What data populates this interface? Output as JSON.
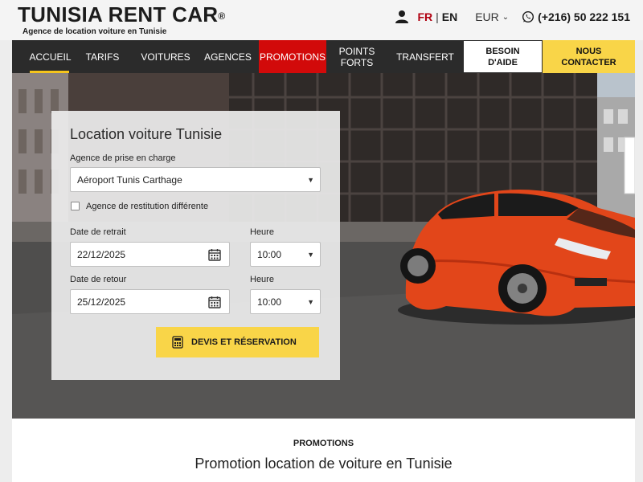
{
  "brand": {
    "title": "TUNISIA RENT CAR",
    "registered": "®",
    "tagline": "Agence de location voiture en Tunisie"
  },
  "header": {
    "lang_fr": "FR",
    "lang_sep": "|",
    "lang_en": "EN",
    "currency": "EUR",
    "phone": "(+216) 50 222 151"
  },
  "nav": {
    "items": [
      {
        "label": "ACCUEIL"
      },
      {
        "label": "TARIFS"
      },
      {
        "label": "VOITURES"
      },
      {
        "label": "AGENCES"
      },
      {
        "label": "PROMOTIONS"
      },
      {
        "label": "POINTS FORTS"
      },
      {
        "label": "TRANSFERT"
      }
    ],
    "help": "BESOIN D'AIDE",
    "contact": "NOUS CONTACTER"
  },
  "form": {
    "title": "Location voiture Tunisie",
    "pickup_label": "Agence de prise en charge",
    "pickup_value": "Aéroport Tunis Carthage",
    "return_diff_label": "Agence de restitution différente",
    "pickup_date_label": "Date de retrait",
    "pickup_date": "22/12/2025",
    "pickup_time_label": "Heure",
    "pickup_time": "10:00",
    "return_date_label": "Date de retour",
    "return_date": "25/12/2025",
    "return_time_label": "Heure",
    "return_time": "10:00",
    "submit": "DEVIS ET RÉSERVATION"
  },
  "promotions": {
    "kicker": "PROMOTIONS",
    "heading": "Promotion location de voiture en Tunisie"
  },
  "colors": {
    "accent_yellow": "#f9d548",
    "promo_red": "#d20a0a",
    "nav_bg": "#2b2b2b",
    "lang_active": "#b00010"
  },
  "icons": {
    "user": "user-icon",
    "whatsapp": "whatsapp-icon",
    "calendar": "calendar-icon",
    "calculator": "calculator-icon",
    "chevron": "chevron-down-icon"
  }
}
